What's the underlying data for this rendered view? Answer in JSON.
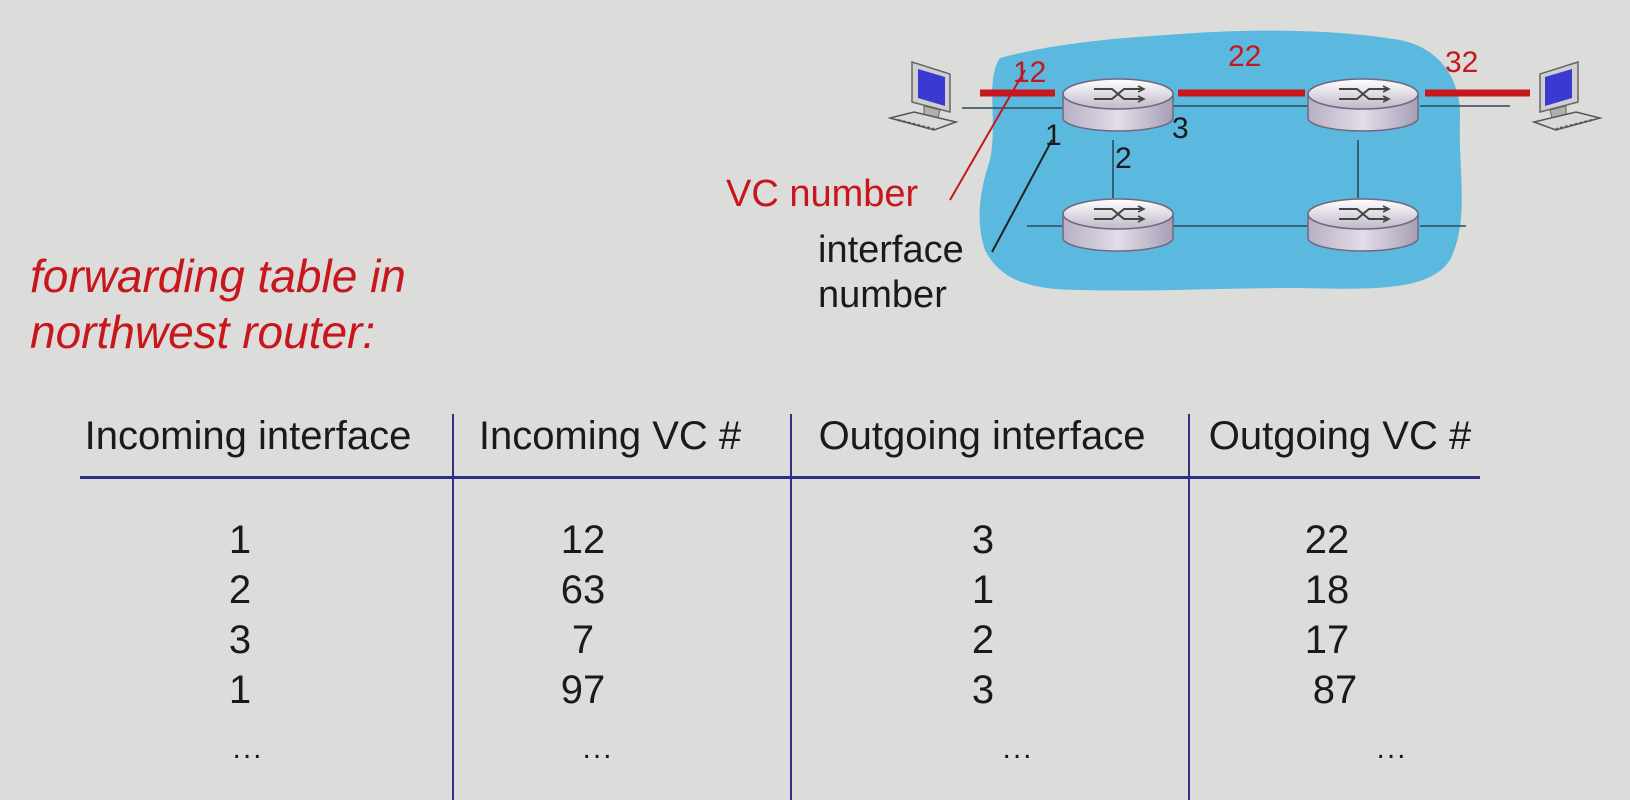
{
  "heading": {
    "line1": "forwarding table in",
    "line2": "northwest router:"
  },
  "diagram": {
    "vc_labels": [
      "12",
      "22",
      "32"
    ],
    "interface_labels": [
      "1",
      "2",
      "3"
    ],
    "vc_number_label": "VC number",
    "interface_number_label_line1": "interface",
    "interface_number_label_line2": "number",
    "colors": {
      "cloud": "#5bb8de",
      "vc_red": "#c8161d",
      "router": "#c9c2d3"
    }
  },
  "table": {
    "headers": [
      "Incoming interface",
      "Incoming VC #",
      "Outgoing interface",
      "Outgoing VC #"
    ],
    "rows": [
      [
        "1",
        "12",
        "3",
        "22"
      ],
      [
        "2",
        "63",
        "1",
        "18"
      ],
      [
        "3",
        "7",
        "2",
        "17"
      ],
      [
        "1",
        "97",
        "3",
        "87"
      ]
    ],
    "ellipsis": "..."
  }
}
